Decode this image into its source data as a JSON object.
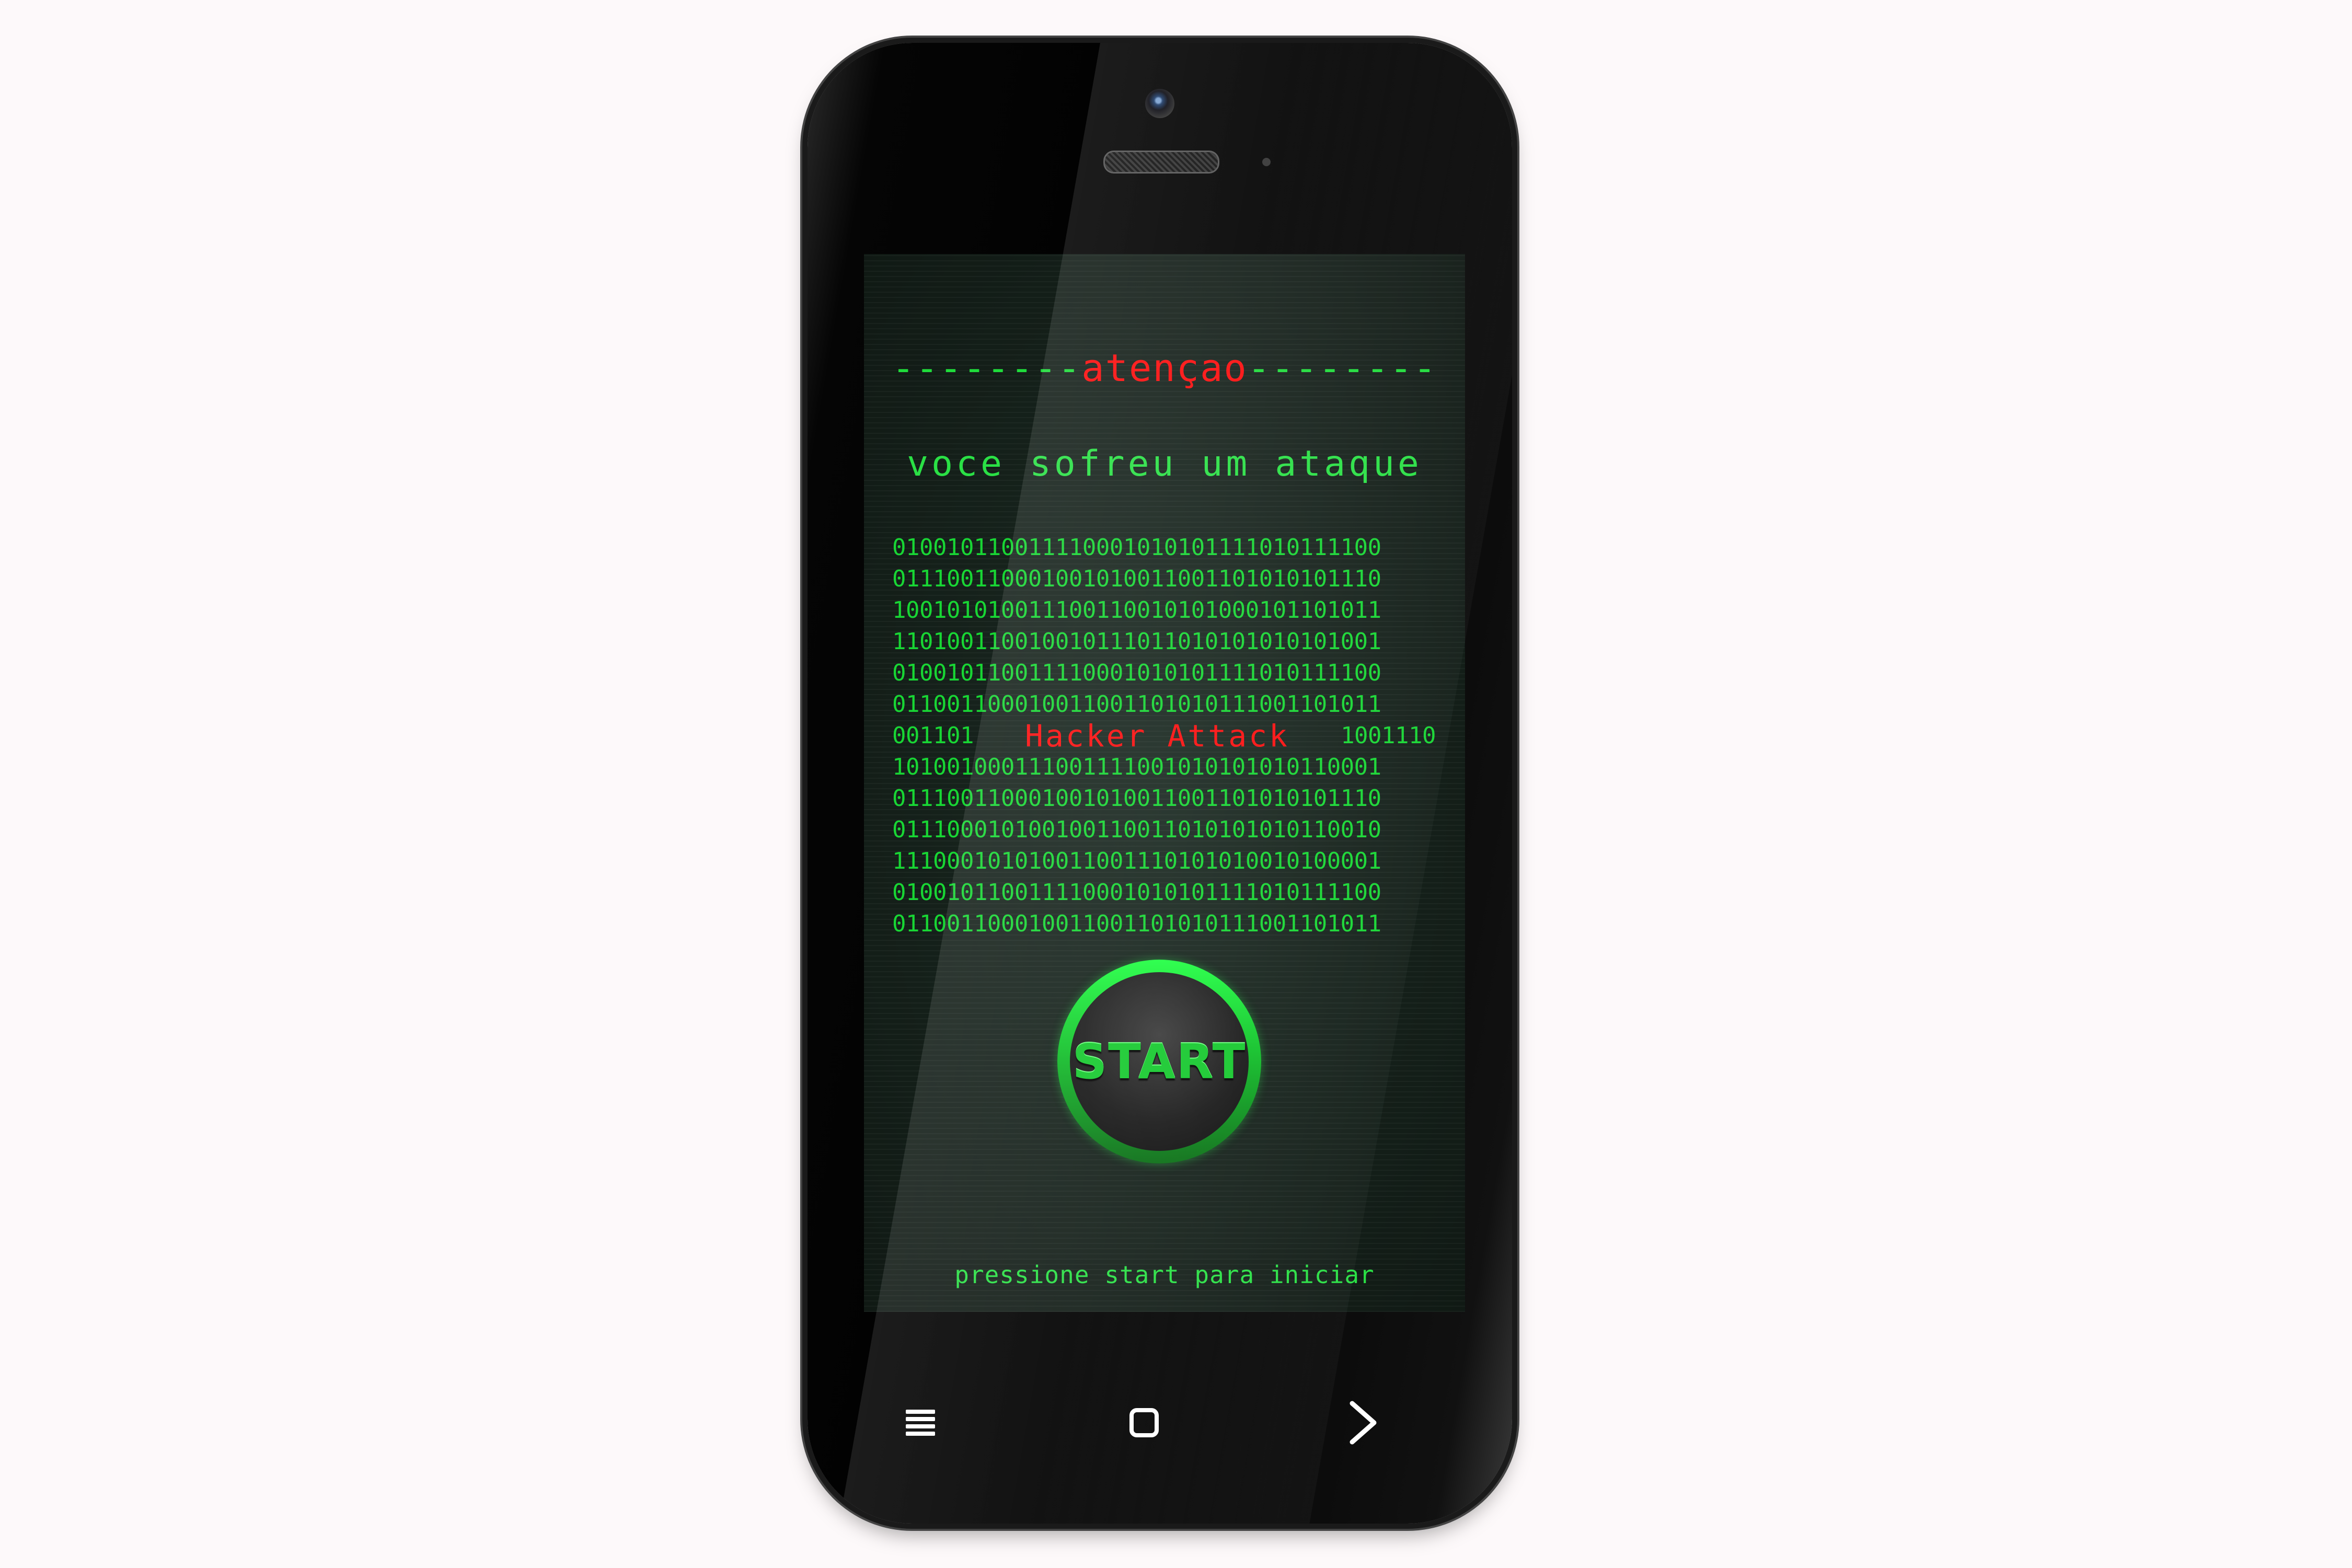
{
  "screen": {
    "header": {
      "dashes_left": "--------",
      "word": "atençao",
      "dashes_right": "--------"
    },
    "subtitle": "voce sofreu um ataque",
    "binary": {
      "lines": [
        "010010110011110001010101111010111100",
        "011100110001001010011001101010101110",
        "100101010011100110010101000101101011",
        "110100110010010111011010101010101001",
        "010010110011110001010101111010111100",
        "011001100010011001101010111001101011"
      ],
      "attack_line": {
        "left": "001101",
        "text": "Hacker Attack",
        "right": "1001110"
      },
      "lines_after": [
        "101001000111001111001010101010110001",
        "011100110001001010011001101010101110",
        "011100010100100110011010101010110010",
        "111000101010011001110101010010100001",
        "010010110011110001010101111010111100",
        "011001100010011001101010111001101011"
      ]
    },
    "start_button_label": "START",
    "footer_text": "pressione start para iniciar"
  },
  "colors": {
    "green": "#1fdc3b",
    "red": "#ff0d0d",
    "screen_bg": "#14201a"
  },
  "navbar": {
    "menu_icon": "menu-lines-icon",
    "home_icon": "home-square-icon",
    "back_icon": "chevron-right-icon"
  }
}
